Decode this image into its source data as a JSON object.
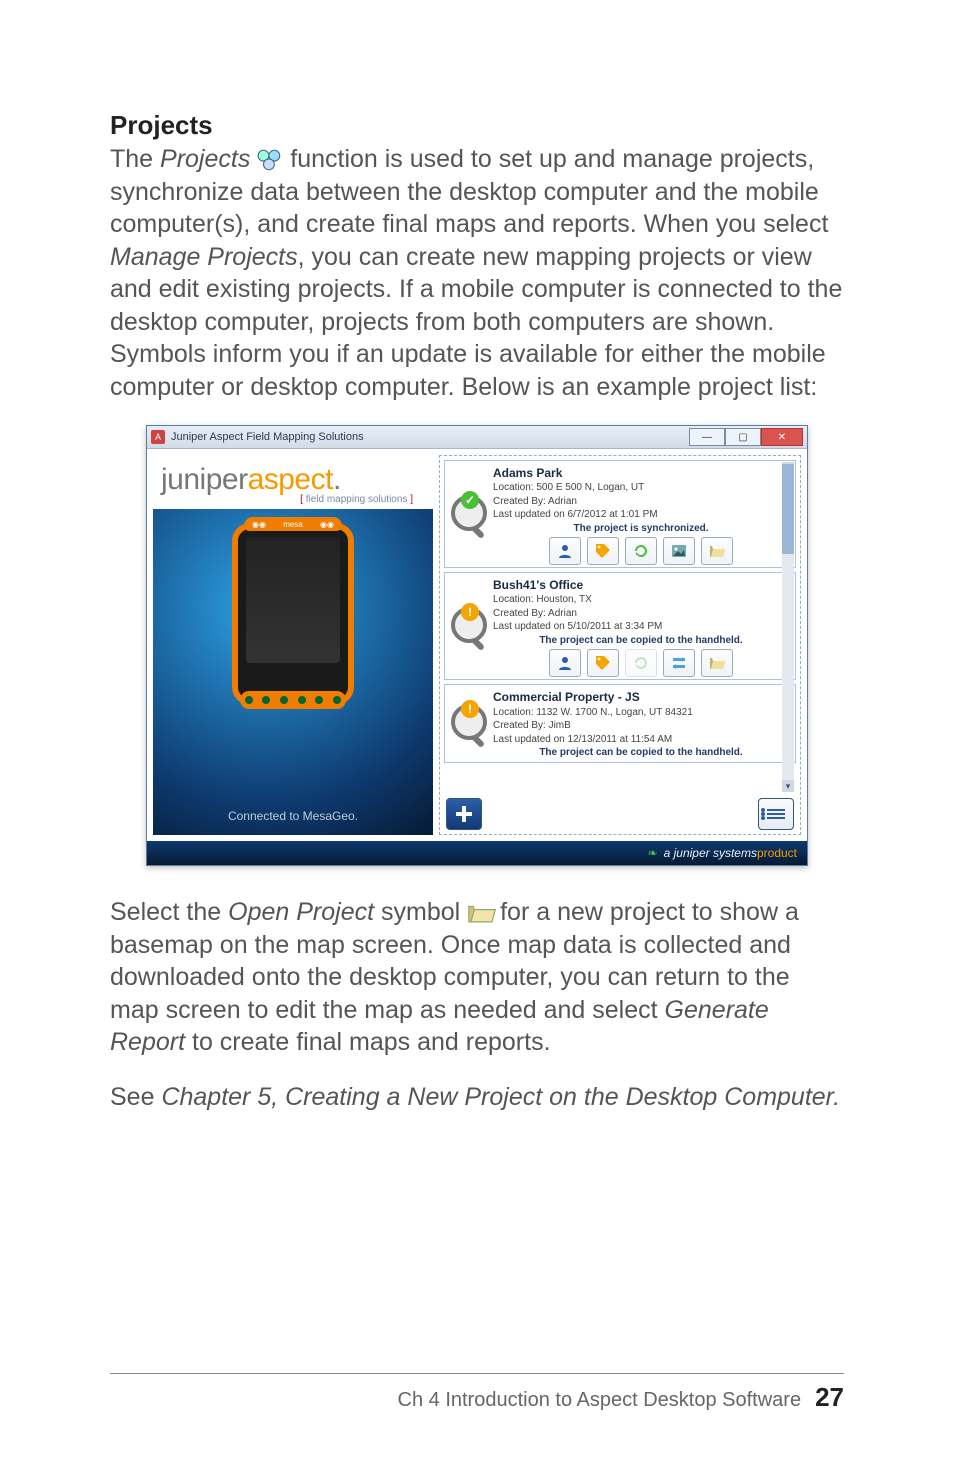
{
  "section": {
    "heading": "Projects"
  },
  "para1": {
    "t1": "The ",
    "em1": "Projects ",
    "t2": " function is used to set up and manage projects, synchronize data between the desktop computer and the mobile computer(s), and create final maps and reports. When you select ",
    "em2": "Manage Projects",
    "t3": ", you can create new mapping projects or view and edit existing projects. If a mobile computer is connected to the desktop computer, projects from both computers are shown. Symbols inform you if an update is available for either the mobile computer or desktop computer. Below is an example project list:"
  },
  "para2": {
    "t1": "Select the ",
    "em1": "Open Project",
    "t2": " symbol ",
    "t3": " for a new project to show a basemap on the map screen. Once map data is collected and downloaded onto the desktop computer, you can return to the map screen to edit the map as needed and select ",
    "em2": "Generate Report",
    "t4": " to create final maps and reports."
  },
  "para3": {
    "t1": "See ",
    "em1": "Chapter 5, Creating a New Project on the Desktop Computer."
  },
  "window": {
    "title": "Juniper Aspect Field Mapping Solutions",
    "logo": {
      "pre": "juniper",
      "mid": "aspect",
      "dot": ".",
      "sub_l": "[ ",
      "sub_txt": "field mapping solutions",
      "sub_r": " ]"
    },
    "device": {
      "brand": "mesa",
      "status": "Connected to MesaGeo."
    },
    "footer": {
      "text": "a juniper systems ",
      "accent": "product"
    }
  },
  "icons": {
    "check": "✓",
    "warn": "!",
    "scroll_up": "▴",
    "scroll_down": "▾"
  },
  "projects": [
    {
      "name": "Adams Park",
      "location": "Location:  500 E 500 N, Logan, UT",
      "created": "Created By:  Adrian",
      "updated": "Last updated on 6/7/2012 at 1:01 PM",
      "status": "The project is synchronized.",
      "status_kind": "ok",
      "tools": [
        "person",
        "tag",
        "refresh",
        "image",
        "open"
      ],
      "disabled": []
    },
    {
      "name": "Bush41's Office",
      "location": "Location:  Houston, TX",
      "created": "Created By:  Adrian",
      "updated": "Last updated on 5/10/2011 at 3:34 PM",
      "status": "The project can be copied to the handheld.",
      "status_kind": "warn",
      "tools": [
        "person",
        "tag",
        "refresh",
        "sync",
        "open"
      ],
      "disabled": [
        "refresh"
      ]
    },
    {
      "name": "Commercial Property - JS",
      "location": "Location:  1132 W. 1700 N., Logan, UT  84321",
      "created": "Created By:  JimB",
      "updated": "Last updated on 12/13/2011 at 11:54 AM",
      "status": "The project can be copied to the handheld.",
      "status_kind": "warn",
      "tools": [],
      "disabled": []
    }
  ],
  "footer": {
    "chapter": "Ch 4   Introduction to Aspect Desktop Software",
    "page": "27"
  }
}
